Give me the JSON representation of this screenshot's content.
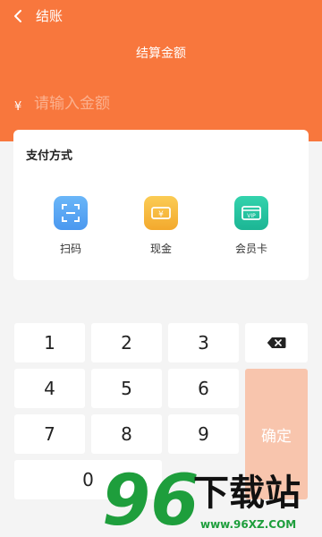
{
  "header": {
    "title": "结账",
    "amount_label": "结算金额",
    "currency_symbol": "¥",
    "amount_placeholder": "请输入金额",
    "amount_value": ""
  },
  "payment": {
    "title": "支付方式",
    "options": [
      {
        "label": "扫码",
        "icon": "scan-icon",
        "color": "#5aa7f5"
      },
      {
        "label": "现金",
        "icon": "cash-icon",
        "color": "#f7b942"
      },
      {
        "label": "会员卡",
        "icon": "vip-card-icon",
        "color": "#26c4a0"
      }
    ]
  },
  "keypad": {
    "digits": [
      "1",
      "2",
      "3",
      "4",
      "5",
      "6",
      "7",
      "8",
      "9",
      "0"
    ],
    "backspace_icon": "backspace-icon",
    "confirm_label": "确定"
  },
  "watermark": {
    "number": "96",
    "text": "下载站",
    "url": "www.96XZ.COM"
  },
  "colors": {
    "accent": "#f8773d",
    "confirm": "#f8c5ad",
    "scan": "#5aa7f5",
    "cash": "#f7b942",
    "vip": "#26c4a0"
  }
}
